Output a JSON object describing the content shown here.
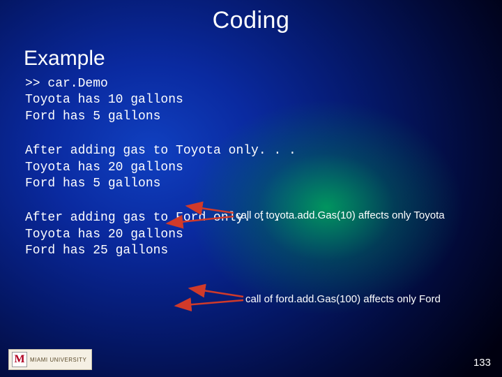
{
  "title": "Coding",
  "subtitle": "Example",
  "code_block1": ">> car.Demo\nToyota has 10 gallons\nFord has 5 gallons",
  "code_block2": "After adding gas to Toyota only. . .\nToyota has 20 gallons\nFord has 5 gallons",
  "code_block3": "After adding gas to Ford only. . .\nToyota has 20 gallons\nFord has 25 gallons",
  "annotation1": "call of toyota.add.Gas(10) affects only Toyota",
  "annotation2": "call of ford.add.Gas(100) affects only Ford",
  "logo_letter": "M",
  "logo_text": "MIAMI UNIVERSITY",
  "page_number": "133"
}
